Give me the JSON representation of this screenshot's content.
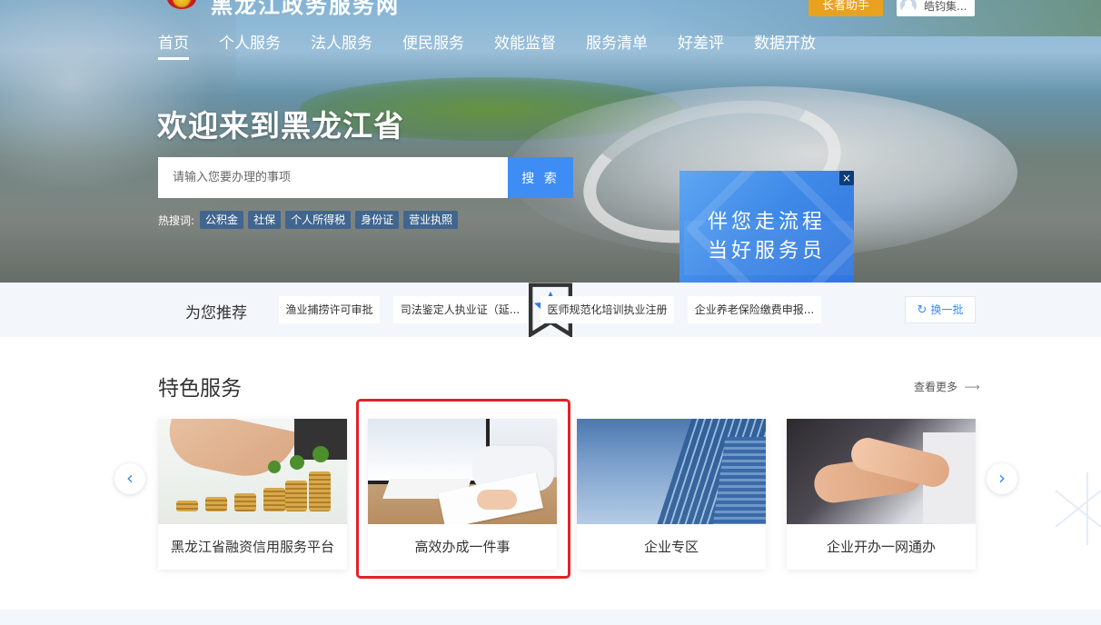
{
  "header": {
    "site_title": "黑龙江政务服务网",
    "elder_assistant": "长者助手",
    "user_name": "皓钧集..."
  },
  "nav": {
    "items": [
      "首页",
      "个人服务",
      "法人服务",
      "便民服务",
      "效能监督",
      "服务清单",
      "好差评",
      "数据开放"
    ],
    "active_index": 0
  },
  "hero": {
    "welcome": "欢迎来到黑龙江省",
    "search_placeholder": "请输入您要办理的事项",
    "search_button": "搜 索",
    "hot_label": "热搜词:",
    "hot_tags": [
      "公积金",
      "社保",
      "个人所得税",
      "身份证",
      "营业执照"
    ]
  },
  "promo": {
    "line1": "伴您走流程",
    "line2": "当好服务员",
    "close": "×"
  },
  "recommend": {
    "title": "为您推荐",
    "items": [
      "渔业捕捞许可审批",
      "司法鉴定人执业证（延...",
      "医师规范化培训执业注册",
      "企业养老保险缴费申报..."
    ],
    "refresh": "换一批"
  },
  "featured": {
    "title": "特色服务",
    "more": "查看更多",
    "cards": [
      {
        "label": "黑龙江省融资信用服务平台"
      },
      {
        "label": "高效办成一件事"
      },
      {
        "label": "企业专区"
      },
      {
        "label": "企业开办一网通办"
      }
    ],
    "prev": "‹",
    "next": "›"
  },
  "colors": {
    "accent": "#3d8df5",
    "elder": "#e8a21f",
    "highlight": "#e2222a"
  }
}
